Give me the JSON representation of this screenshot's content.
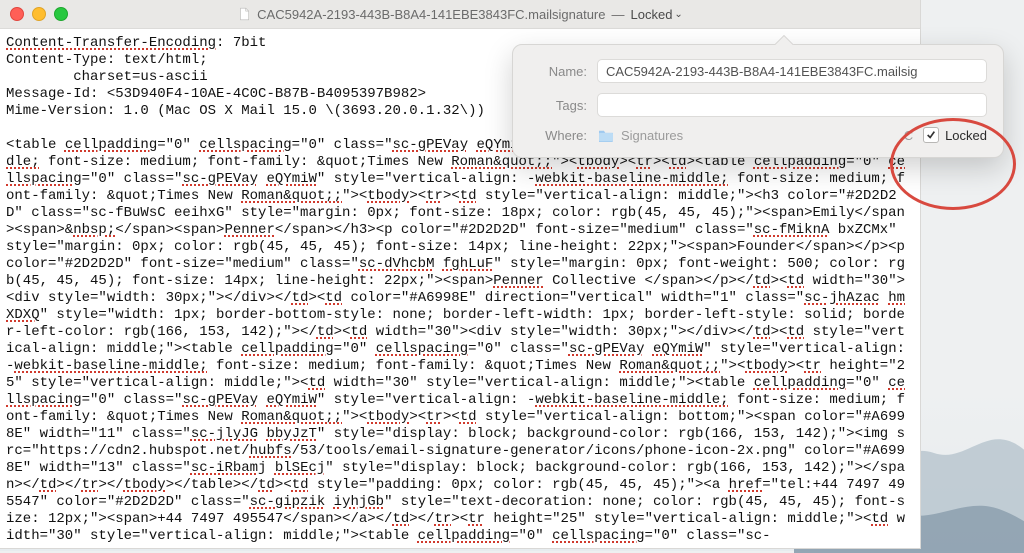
{
  "titlebar": {
    "filename": "CAC5942A-2193-443B-B8A4-141EBE3843FC.mailsignature",
    "separator": "—",
    "locked_label": "Locked"
  },
  "content": {
    "lines": [
      "Content-Transfer-Encoding: 7bit",
      "Content-Type: text/html;",
      "        charset=us-ascii",
      "Message-Id: <53D940F4-10AE-4C0C-B87B-B4095397B982>",
      "Mime-Version: 1.0 (Mac OS X Mail 15.0 \\(3693.20.0.1.32\\))",
      "",
      "<table cellpadding=\"0\" cellspacing=\"0\" class=\"sc-gPEVay eQYmiW\" style=\"vertical-align: -webkit-baseline-middle; font-size: medium; font-family: &quot;Times New Roman&quot;;\"><tbody><tr><td><table cellpadding=\"0\" cellspacing=\"0\" class=\"sc-gPEVay eQYmiW\" style=\"vertical-align: -webkit-baseline-middle; font-size: medium; font-family: &quot;Times New Roman&quot;;\"><tbody><tr><td style=\"vertical-align: middle;\"><h3 color=\"#2D2D2D\" class=\"sc-fBuWsC eeihxG\" style=\"margin: 0px; font-size: 18px; color: rgb(45, 45, 45);\"><span>Emily</span><span>&nbsp;</span><span>Penner</span></h3><p color=\"#2D2D2D\" font-size=\"medium\" class=\"sc-fMiknA bxZCMx\" style=\"margin: 0px; color: rgb(45, 45, 45); font-size: 14px; line-height: 22px;\"><span>Founder</span></p><p color=\"#2D2D2D\" font-size=\"medium\" class=\"sc-dVhcbM fghLuF\" style=\"margin: 0px; font-weight: 500; color: rgb(45, 45, 45); font-size: 14px; line-height: 22px;\"><span>Penner Collective </span></p></td><td width=\"30\"><div style=\"width: 30px;\"></div></td><td color=\"#A6998E\" direction=\"vertical\" width=\"1\" class=\"sc-jhAzac hmXDXQ\" style=\"width: 1px; border-bottom-style: none; border-left-width: 1px; border-left-style: solid; border-left-color: rgb(166, 153, 142);\"></td><td width=\"30\"><div style=\"width: 30px;\"></div></td><td style=\"vertical-align: middle;\"><table cellpadding=\"0\" cellspacing=\"0\" class=\"sc-gPEVay eQYmiW\" style=\"vertical-align: -webkit-baseline-middle; font-size: medium; font-family: &quot;Times New Roman&quot;;\"><tbody><tr height=\"25\" style=\"vertical-align: middle;\"><td width=\"30\" style=\"vertical-align: middle;\"><table cellpadding=\"0\" cellspacing=\"0\" class=\"sc-gPEVay eQYmiW\" style=\"vertical-align: -webkit-baseline-middle; font-size: medium; font-family: &quot;Times New Roman&quot;;\"><tbody><tr><td style=\"vertical-align: bottom;\"><span color=\"#A6998E\" width=\"11\" class=\"sc-jlyJG bbyJzT\" style=\"display: block; background-color: rgb(166, 153, 142);\"><img src=\"https://cdn2.hubspot.net/hubfs/53/tools/email-signature-generator/icons/phone-icon-2x.png\" color=\"#A6998E\" width=\"13\" class=\"sc-iRbamj blSEcj\" style=\"display: block; background-color: rgb(166, 153, 142);\"></span></td></tr></tbody></table></td><td style=\"padding: 0px; color: rgb(45, 45, 45);\"><a href=\"tel:+44 7497 495547\" color=\"#2D2D2D\" class=\"sc-gipzik iyhjGb\" style=\"text-decoration: none; color: rgb(45, 45, 45); font-size: 12px;\"><span>+44 7497 495547</span></a></td></tr><tr height=\"25\" style=\"vertical-align: middle;\"><td width=\"30\" style=\"vertical-align: middle;\"><table cellpadding=\"0\" cellspacing=\"0\" class=\"sc-"
    ],
    "spellcheck_words": [
      "webkit",
      "cellpadding",
      "Roman&quot",
      "tbody",
      "tr",
      "td",
      "cellspacing",
      "eQYmiW",
      "fMiknA",
      "Penner",
      "sc-gPEVay",
      "nbsp",
      "sc-dVhcbM",
      "fghLuF",
      "sc-jhAzac",
      "hmXDXQ",
      "sc-jlyJG",
      "bbyJzT",
      "hubfs",
      "px",
      "sc-iRbamj",
      "blSEcj",
      "sc-gipzik",
      "iyhjGb",
      "href"
    ]
  },
  "popover": {
    "name_label": "Name:",
    "name_value": "CAC5942A-2193-443B-B8A4-141EBE3843FC.mailsig",
    "tags_label": "Tags:",
    "tags_value": "",
    "where_label": "Where:",
    "where_folder": "Signatures",
    "where_suffix": "C",
    "locked_label": "Locked",
    "locked_checked": true
  }
}
